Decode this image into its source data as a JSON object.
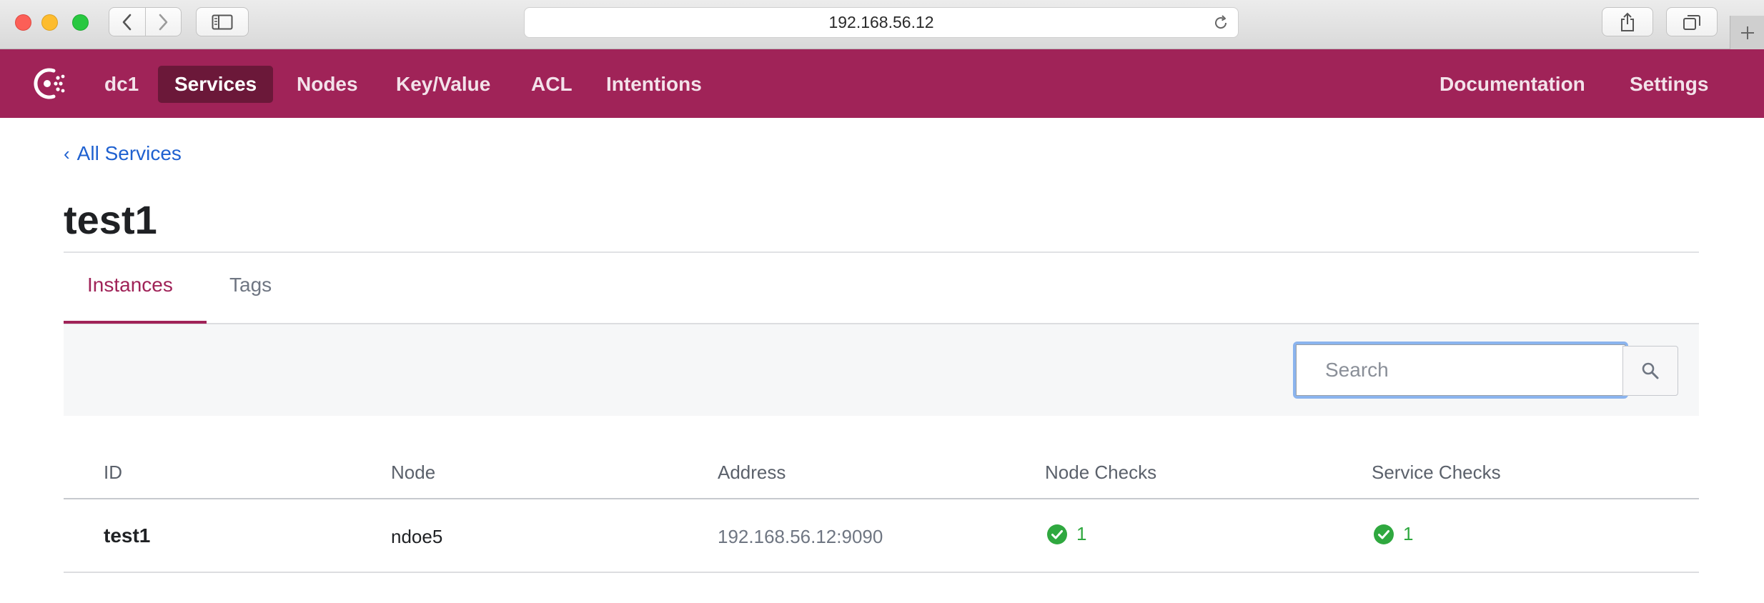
{
  "browser": {
    "url": "192.168.56.12",
    "icons": {
      "back": "chevron-left-icon",
      "forward": "chevron-right-icon",
      "sidebar": "sidebar-icon",
      "reload": "reload-icon",
      "share": "share-icon",
      "tabs": "tabs-overview-icon",
      "new_tab": "plus-icon"
    }
  },
  "nav": {
    "brand_color": "#a02358",
    "active_bg": "#6b1839",
    "logo": "consul-logo-icon",
    "datacenter": "dc1",
    "items": [
      {
        "label": "Services",
        "active": true
      },
      {
        "label": "Nodes",
        "active": false
      },
      {
        "label": "Key/Value",
        "active": false
      },
      {
        "label": "ACL",
        "active": false
      },
      {
        "label": "Intentions",
        "active": false
      }
    ],
    "right_items": [
      {
        "label": "Documentation"
      },
      {
        "label": "Settings"
      }
    ]
  },
  "breadcrumb": {
    "label": "All Services"
  },
  "page": {
    "title": "test1"
  },
  "tabs": [
    {
      "label": "Instances",
      "active": true
    },
    {
      "label": "Tags",
      "active": false
    }
  ],
  "search": {
    "placeholder": "Search",
    "value": "",
    "icon": "search-icon"
  },
  "table": {
    "columns": [
      "ID",
      "Node",
      "Address",
      "Node Checks",
      "Service Checks"
    ],
    "rows": [
      {
        "id": "test1",
        "node": "ndoe5",
        "address": "192.168.56.12:9090",
        "node_checks": "1",
        "service_checks": "1"
      }
    ],
    "check_color": "#2fa83f"
  }
}
